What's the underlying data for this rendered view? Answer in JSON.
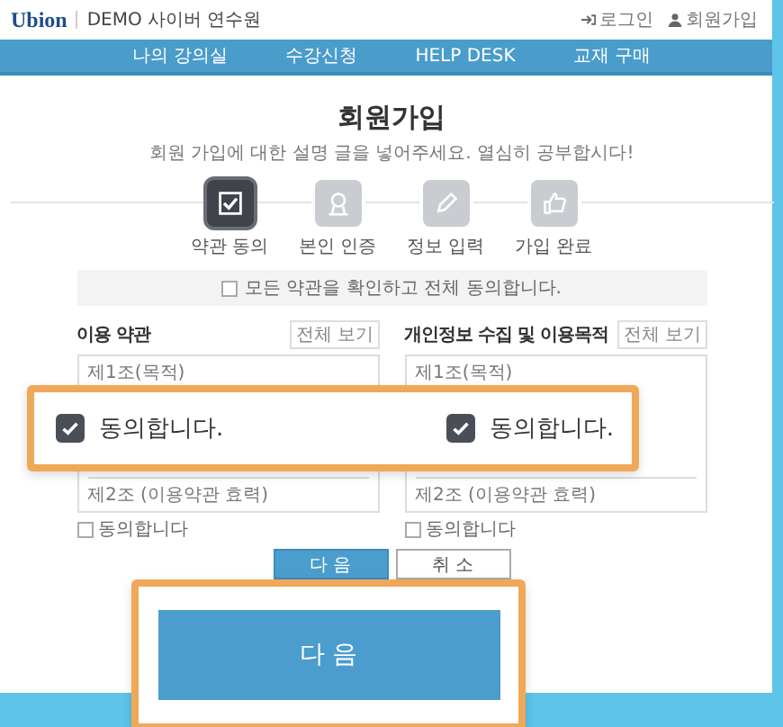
{
  "header": {
    "logo": "Ubion",
    "site_name": "DEMO 사이버 연수원",
    "links": [
      {
        "kind": "login",
        "label": "로그인"
      },
      {
        "kind": "member",
        "label": "회원가입"
      }
    ]
  },
  "nav": [
    "나의 강의실",
    "수강신청",
    "HELP DESK",
    "교재 구매"
  ],
  "title": "회원가입",
  "subtitle": "회원 가입에 대한 설명 글을 넣어주세요. 열심히 공부합시다!",
  "steps": [
    {
      "kind": "check",
      "label": "약관 동의",
      "selected": true
    },
    {
      "kind": "person",
      "label": "본인 인증",
      "selected": false
    },
    {
      "kind": "pencil",
      "label": "정보 입력",
      "selected": false
    },
    {
      "kind": "thumb",
      "label": "가입 완료",
      "selected": false
    }
  ],
  "agree_all": {
    "label": "모든 약관을 확인하고 전체 동의합니다.",
    "checked": false
  },
  "terms": [
    {
      "title": "이용 약관",
      "view_all": "전체 보기",
      "first_line": "제1조(목적)",
      "last_line": "제2조 (이용약관 효력)",
      "agree": {
        "label": "동의합니다",
        "checked": false
      }
    },
    {
      "title": "개인정보 수집 및 이용목적",
      "view_all": "전체 보기",
      "first_line": "제1조(목적)",
      "last_line": "제2조 (이용약관 효력)",
      "agree": {
        "label": "동의합니다",
        "checked": false
      }
    }
  ],
  "buttons": [
    {
      "kind": "primary",
      "label": "다 음"
    },
    {
      "kind": "secondary",
      "label": "취 소"
    }
  ],
  "callouts": [
    {
      "kind": "agree",
      "items": [
        {
          "label": "동의합니다.",
          "checked": true
        },
        {
          "label": "동의합니다.",
          "checked": true
        }
      ]
    },
    {
      "kind": "button",
      "label": "다 음"
    }
  ]
}
